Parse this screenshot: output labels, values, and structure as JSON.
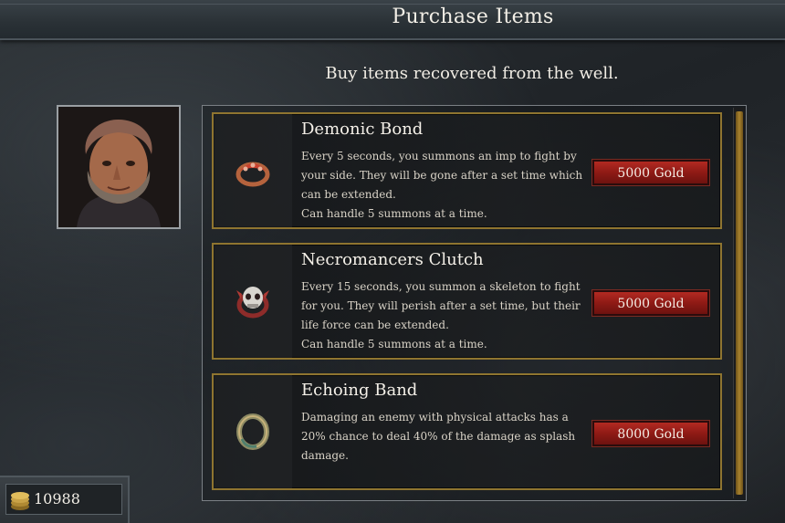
{
  "header": {
    "title": "Purchase Items"
  },
  "subtitle": "Buy items recovered from the well.",
  "portrait": {
    "icon": "merchant-portrait"
  },
  "items": [
    {
      "name": "Demonic Bond",
      "icon": "ring-demonic-icon",
      "description_lines": [
        "Every 5 seconds, you summons an imp to fight by",
        "your side. They will be gone after a set time which",
        "can be extended.",
        "Can handle 5 summons at a time."
      ],
      "price_label": "5000 Gold"
    },
    {
      "name": "Necromancers Clutch",
      "icon": "ring-skull-icon",
      "description_lines": [
        "Every 15 seconds, you summon a skeleton to fight",
        "for you. They will perish after a set time, but their",
        "life force can be extended.",
        "Can handle 5 summons at a time."
      ],
      "price_label": "5000 Gold"
    },
    {
      "name": "Echoing Band",
      "icon": "ring-band-icon",
      "description_lines": [
        "Damaging an enemy with physical attacks has a",
        "20% chance to deal 40% of the damage as splash",
        "damage."
      ],
      "price_label": "8000 Gold"
    }
  ],
  "gold": {
    "amount": "10988",
    "icon": "gold-coins-icon"
  },
  "colors": {
    "button_red": "#a8251e",
    "card_border_gold": "#8f7530",
    "scroll_thumb": "#a8822e"
  }
}
